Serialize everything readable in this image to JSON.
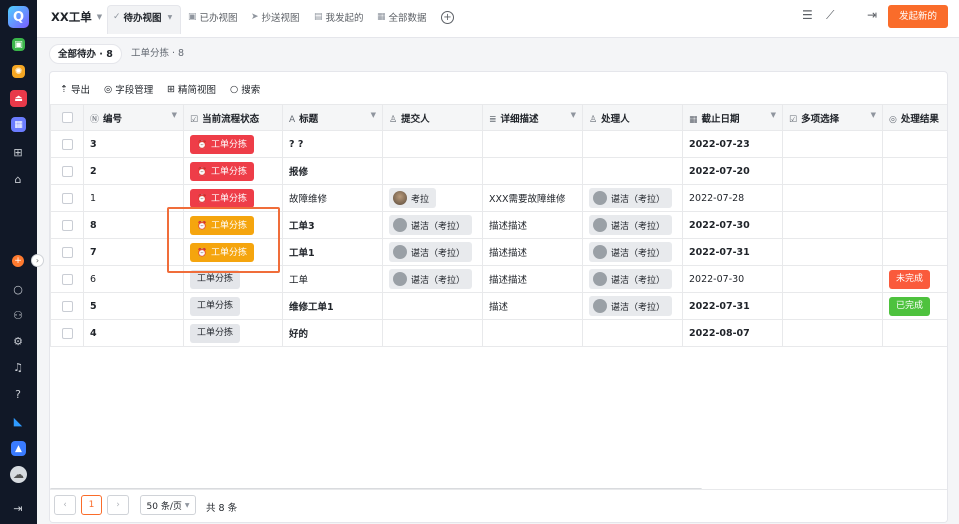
{
  "colors": {
    "accent": "#fa6c2a",
    "sidebar": "#111827",
    "highlight_box": "#f06d3a"
  },
  "topbar": {
    "app_title": "XX工单",
    "tabs": [
      {
        "label": "待办视图",
        "icon": "check-circle-icon",
        "active": true
      },
      {
        "label": "已办视图",
        "icon": "calendar-check-icon"
      },
      {
        "label": "抄送视图",
        "icon": "send-icon"
      },
      {
        "label": "我发起的",
        "icon": "document-icon"
      },
      {
        "label": "全部数据",
        "icon": "table-icon"
      }
    ],
    "create_button": "发起新的"
  },
  "subbar": {
    "filters": [
      {
        "label": "全部待办 · 8",
        "active": true
      },
      {
        "label": "工单分拣 · 8"
      }
    ]
  },
  "toolbar": {
    "export": "导出",
    "fields": "字段管理",
    "simple_view": "精简视图",
    "search": "搜索"
  },
  "table": {
    "columns": [
      {
        "label": "编号",
        "icon": "number-icon"
      },
      {
        "label": "当前流程状态",
        "icon": "checkbox-icon"
      },
      {
        "label": "标题",
        "icon": "text-icon"
      },
      {
        "label": "提交人",
        "icon": "user-icon"
      },
      {
        "label": "详细描述",
        "icon": "paragraph-icon"
      },
      {
        "label": "处理人",
        "icon": "user-icon"
      },
      {
        "label": "截止日期",
        "icon": "calendar-icon"
      },
      {
        "label": "多项选择",
        "icon": "checkbox-icon"
      },
      {
        "label": "处理结果",
        "icon": "radio-icon"
      }
    ],
    "rows": [
      {
        "id": "3",
        "status": "工单分拣",
        "status_style": "red",
        "title": "? ?",
        "submitter": "",
        "desc": "",
        "handler": "",
        "deadline": "2022-07-23",
        "result": "",
        "bold": true
      },
      {
        "id": "2",
        "status": "工单分拣",
        "status_style": "red",
        "title": "报修",
        "submitter": "",
        "desc": "",
        "handler": "",
        "deadline": "2022-07-20",
        "result": "",
        "bold": true
      },
      {
        "id": "1",
        "status": "工单分拣",
        "status_style": "red",
        "title": "故障维修",
        "submitter": "考拉",
        "desc": "XXX需要故障维修",
        "handler": "谌洁（考拉）",
        "deadline": "2022-07-28",
        "result": "",
        "bold": false
      },
      {
        "id": "8",
        "status": "工单分拣",
        "status_style": "yellow",
        "title": "工单3",
        "submitter": "谌洁（考拉）",
        "desc": "描述描述",
        "handler": "谌洁（考拉）",
        "deadline": "2022-07-30",
        "result": "",
        "bold": true
      },
      {
        "id": "7",
        "status": "工单分拣",
        "status_style": "yellow",
        "title": "工单1",
        "submitter": "谌洁（考拉）",
        "desc": "描述描述",
        "handler": "谌洁（考拉）",
        "deadline": "2022-07-31",
        "result": "",
        "bold": true
      },
      {
        "id": "6",
        "status": "工单分拣",
        "status_style": "gray",
        "title": "工单",
        "submitter": "谌洁（考拉）",
        "desc": "描述描述",
        "handler": "谌洁（考拉）",
        "deadline": "2022-07-30",
        "result": "未完成",
        "result_style": "orange",
        "bold": false
      },
      {
        "id": "5",
        "status": "工单分拣",
        "status_style": "gray",
        "title": "维修工单1",
        "submitter": "",
        "desc": "描述",
        "handler": "谌洁（考拉）",
        "deadline": "2022-07-31",
        "result": "已完成",
        "result_style": "green",
        "bold": true
      },
      {
        "id": "4",
        "status": "工单分拣",
        "status_style": "gray",
        "title": "好的",
        "submitter": "",
        "desc": "",
        "handler": "",
        "deadline": "2022-08-07",
        "result": "",
        "bold": true
      }
    ]
  },
  "pager": {
    "current_page": "1",
    "page_size": "50 条/页",
    "total": "共 8 条"
  }
}
